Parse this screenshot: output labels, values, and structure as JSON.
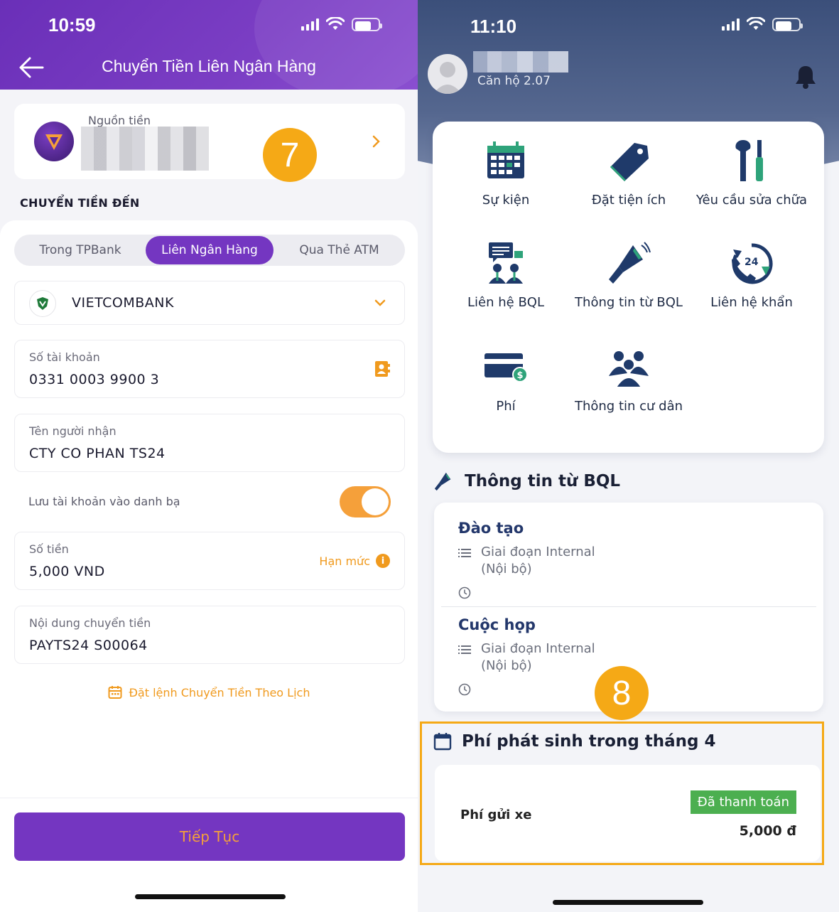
{
  "left": {
    "status_time": "10:59",
    "title": "Chuyển Tiền Liên Ngân Hàng",
    "source_label": "Nguồn tiền",
    "step_badge": "7",
    "section_label": "CHUYỂN TIỀN ĐẾN",
    "tabs": [
      {
        "label": "Trong TPBank",
        "active": false
      },
      {
        "label": "Liên Ngân Hàng",
        "active": true
      },
      {
        "label": "Qua Thẻ ATM",
        "active": false
      }
    ],
    "bank": "VIETCOMBANK",
    "account_label": "Số tài khoản",
    "account_value": "0331 0003 9900 3",
    "recipient_label": "Tên người nhận",
    "recipient_value": "CTY CO PHAN TS24",
    "save_contact_label": "Lưu tài khoản vào danh bạ",
    "save_contact_on": true,
    "amount_label": "Số tiền",
    "amount_value": "5,000 VND",
    "limit_label": "Hạn mức",
    "content_label": "Nội dung chuyển tiền",
    "content_value": "PAYTS24 S00064",
    "schedule_link": "Đặt lệnh Chuyển Tiền Theo Lịch",
    "continue_button": "Tiếp Tục",
    "colors": {
      "primary": "#7436c1",
      "accent": "#f5a03a"
    }
  },
  "right": {
    "status_time": "11:10",
    "apartment": "Căn hộ 2.07",
    "grid": [
      {
        "label": "Sự kiện",
        "icon": "calendar-icon"
      },
      {
        "label": "Đặt tiện ích",
        "icon": "tag-icon"
      },
      {
        "label": "Yêu cầu sửa chữa",
        "icon": "tools-icon"
      },
      {
        "label": "Liên hệ BQL",
        "icon": "meeting-icon"
      },
      {
        "label": "Thông tin từ BQL",
        "icon": "megaphone-icon"
      },
      {
        "label": "Liên hệ khẩn",
        "icon": "phone-24-icon"
      },
      {
        "label": "Phí",
        "icon": "card-payment-icon"
      },
      {
        "label": "Thông tin cư dân",
        "icon": "residents-icon"
      }
    ],
    "news_header": "Thông tin từ BQL",
    "news": [
      {
        "title": "Đào tạo",
        "meta": "Giai đoạn Internal (Nội bộ)"
      },
      {
        "title": "Cuộc họp",
        "meta": "Giai đoạn Internal (Nội bộ)"
      }
    ],
    "step_badge": "8",
    "fees_header": "Phí phát sinh trong tháng 4",
    "fee": {
      "name": "Phí gửi xe",
      "status": "Đã thanh toán",
      "amount": "5,000 đ"
    },
    "colors": {
      "header": "#3b4f7a",
      "paid": "#4caf50",
      "highlight": "#f5a916"
    }
  }
}
